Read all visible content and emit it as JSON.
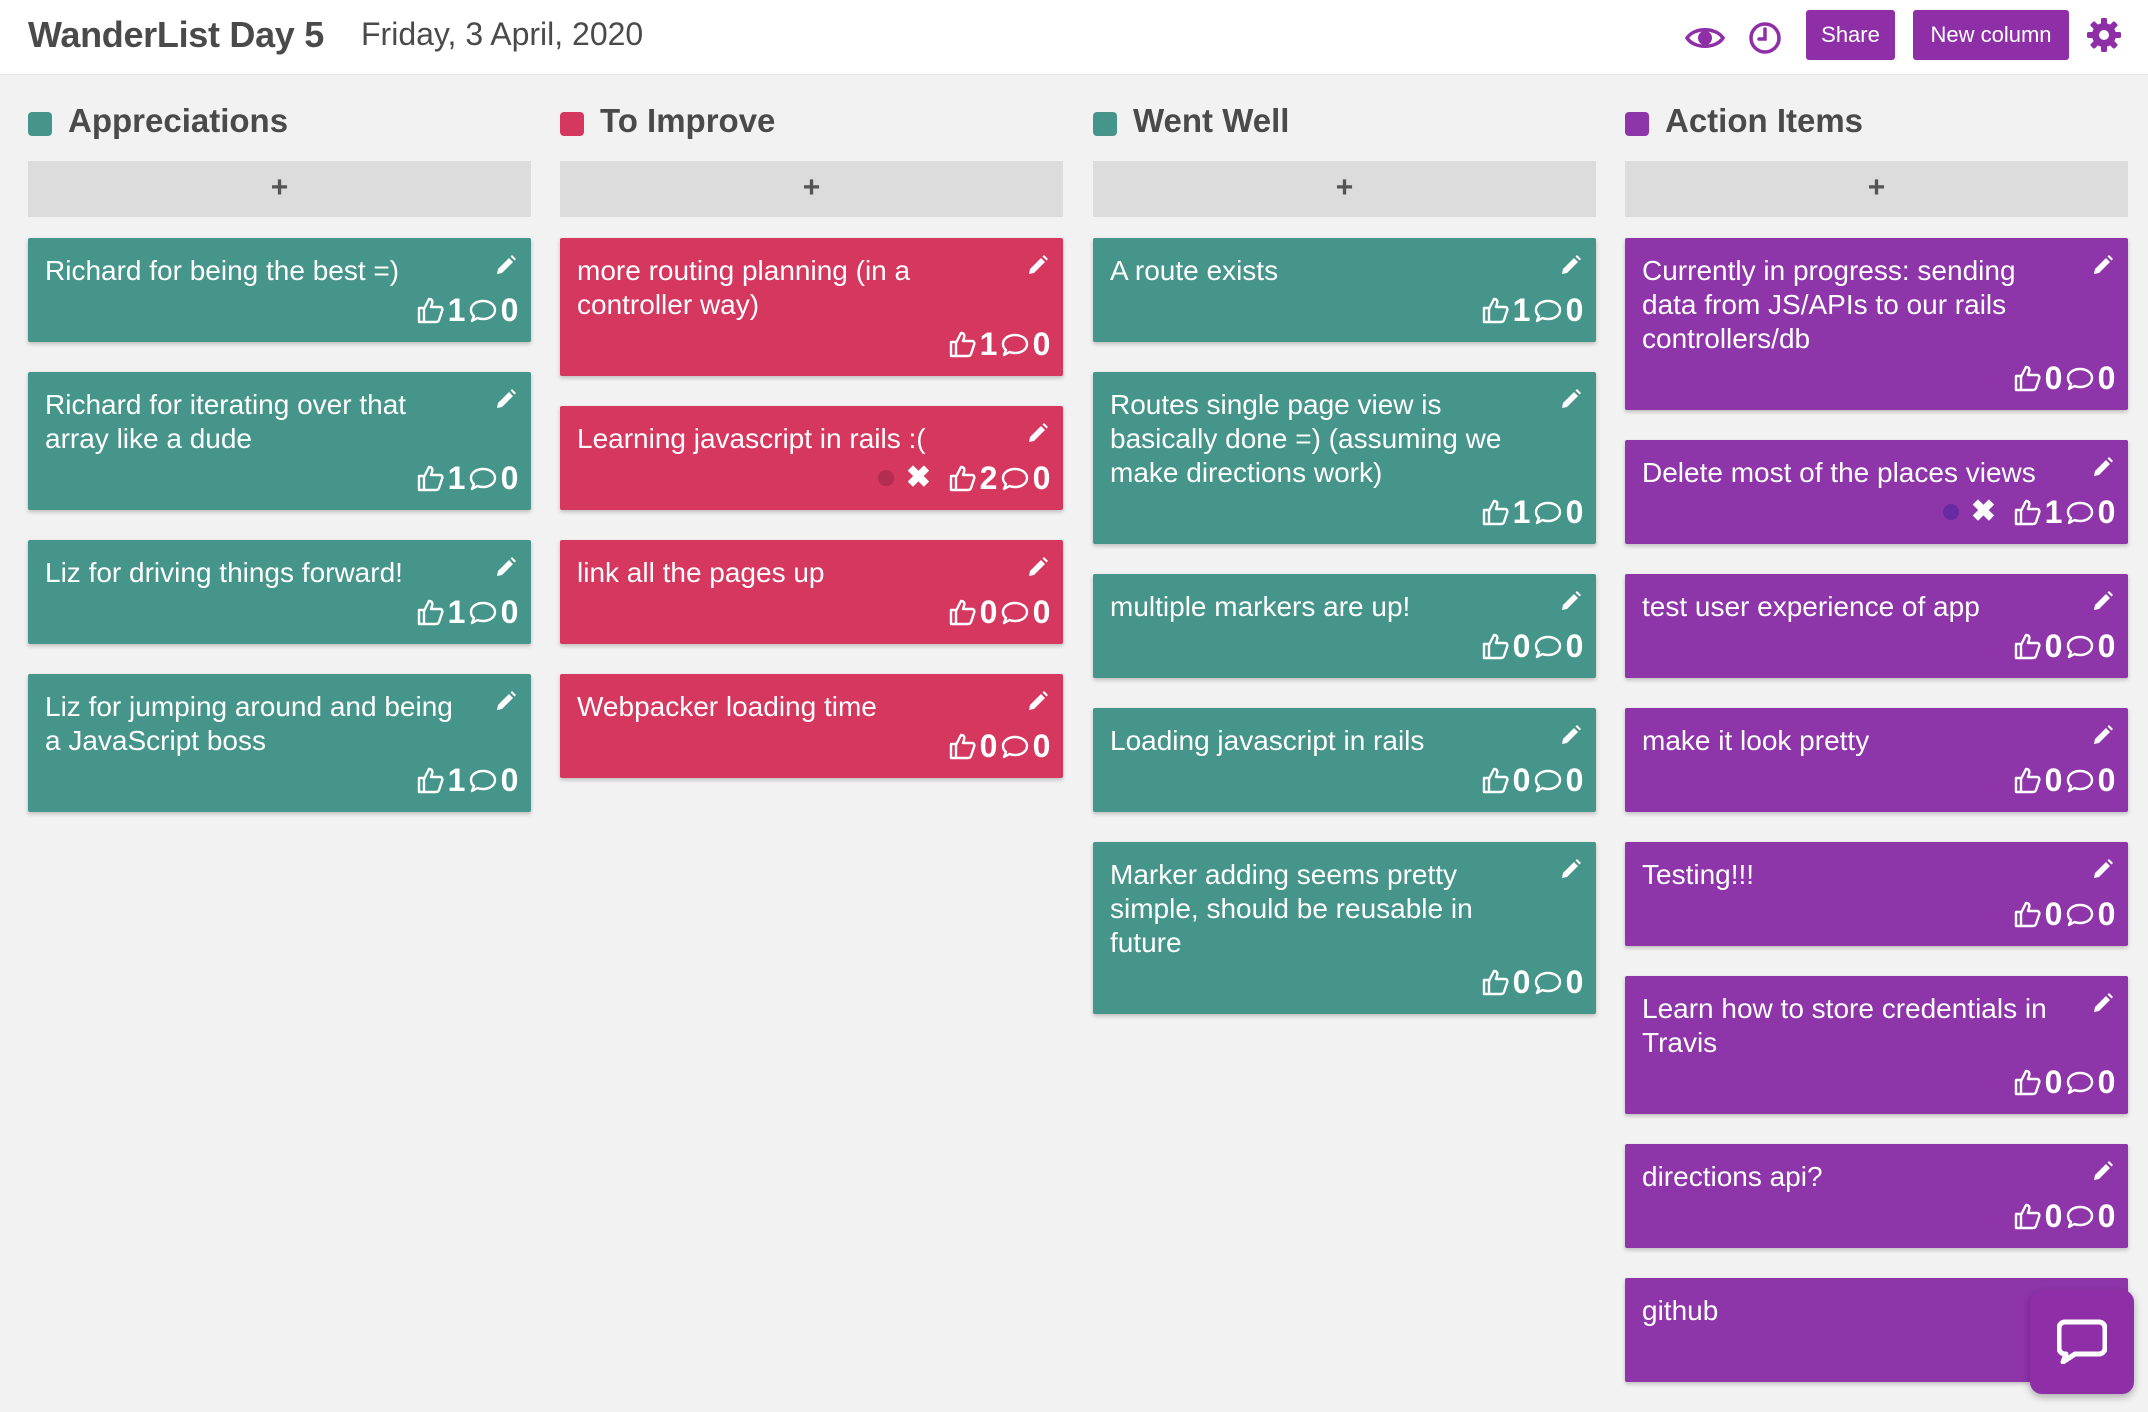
{
  "header": {
    "title": "WanderList Day 5",
    "date": "Friday, 3 April, 2020",
    "share_label": "Share",
    "new_column_label": "New column",
    "icons": [
      "eye-icon",
      "clock-icon",
      "gear-icon"
    ],
    "accent_color": "#8e2fa8"
  },
  "columns": [
    {
      "title": "Appreciations",
      "color": "#46958a",
      "add_label": "+",
      "cards": [
        {
          "text": "Richard for being the best =)",
          "votes": "1",
          "comments": "0"
        },
        {
          "text": "Richard for iterating over that array like a dude",
          "votes": "1",
          "comments": "0"
        },
        {
          "text": "Liz for driving things forward!",
          "votes": "1",
          "comments": "0"
        },
        {
          "text": "Liz for jumping around and being a JavaScript boss",
          "votes": "1",
          "comments": "0"
        }
      ]
    },
    {
      "title": "To Improve",
      "color": "#d6375f",
      "add_label": "+",
      "cards": [
        {
          "text": "more routing planning (in a controller way)",
          "votes": "1",
          "comments": "0"
        },
        {
          "text": "Learning javascript in rails :(",
          "votes": "2",
          "comments": "0",
          "voted_by_me": true
        },
        {
          "text": "link all the pages up",
          "votes": "0",
          "comments": "0"
        },
        {
          "text": "Webpacker loading time",
          "votes": "0",
          "comments": "0"
        }
      ]
    },
    {
      "title": "Went Well",
      "color": "#46958a",
      "add_label": "+",
      "cards": [
        {
          "text": "A route exists",
          "votes": "1",
          "comments": "0"
        },
        {
          "text": "Routes single page view is basically done =) (assuming we make directions work)",
          "votes": "1",
          "comments": "0"
        },
        {
          "text": "multiple markers are up!",
          "votes": "0",
          "comments": "0"
        },
        {
          "text": "Loading javascript in rails",
          "votes": "0",
          "comments": "0"
        },
        {
          "text": "Marker adding seems pretty simple, should be reusable in future",
          "votes": "0",
          "comments": "0"
        }
      ]
    },
    {
      "title": "Action Items",
      "color": "#8e35aa",
      "add_label": "+",
      "cards": [
        {
          "text": "Currently in progress: sending data from JS/APIs to our rails controllers/db",
          "votes": "0",
          "comments": "0"
        },
        {
          "text": "Delete most of the places views",
          "votes": "1",
          "comments": "0",
          "voted_by_me": true
        },
        {
          "text": "test user experience of app",
          "votes": "0",
          "comments": "0"
        },
        {
          "text": "make it look pretty",
          "votes": "0",
          "comments": "0"
        },
        {
          "text": "Testing!!!",
          "votes": "0",
          "comments": "0"
        },
        {
          "text": "Learn how to store credentials in Travis",
          "votes": "0",
          "comments": "0"
        },
        {
          "text": "directions api?",
          "votes": "0",
          "comments": "0"
        },
        {
          "text": "github",
          "votes": "",
          "comments": "",
          "partially_hidden": true
        }
      ]
    }
  ],
  "chat_widget": {
    "icon": "chat-bubble-icon"
  }
}
